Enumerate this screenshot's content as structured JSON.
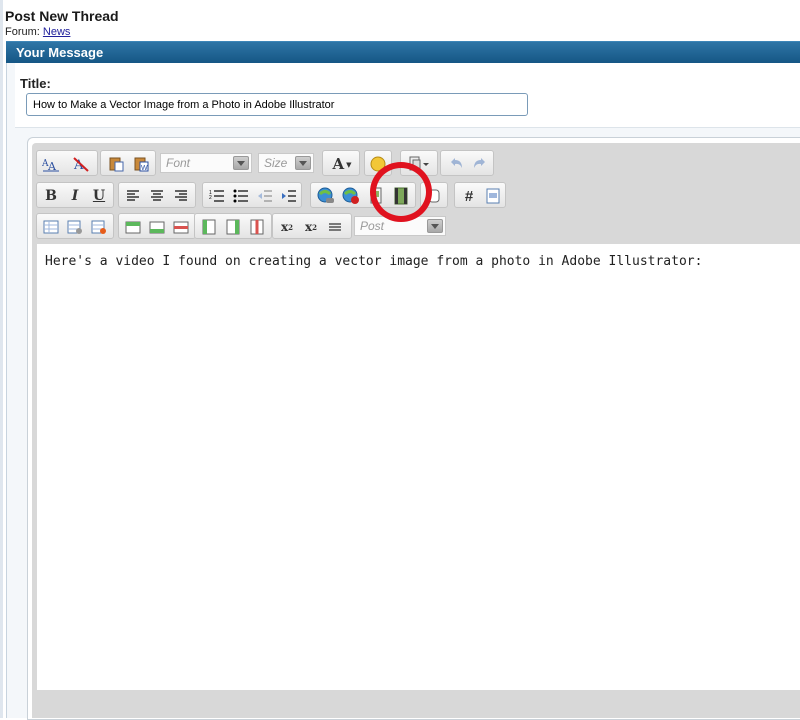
{
  "header": {
    "title": "Post New Thread",
    "forum_label": "Forum:",
    "forum_link": "News"
  },
  "panel": {
    "title": "Your Message"
  },
  "title_field": {
    "label": "Title:",
    "value": "How to Make a Vector Image from a Photo in Adobe Illustrator"
  },
  "toolbar": {
    "font_placeholder": "Font",
    "size_placeholder": "Size",
    "text_color_glyph": "A",
    "bold": "B",
    "italic": "I",
    "underline": "U",
    "hash": "#",
    "sub": "x",
    "sup": "x",
    "style_placeholder": "Post"
  },
  "editor": {
    "body": "Here's a video I found on creating a vector image from a photo in Adobe Illustrator:"
  },
  "colors": {
    "panel_bar": "#1d6494",
    "highlight_ring": "#e0121f"
  }
}
